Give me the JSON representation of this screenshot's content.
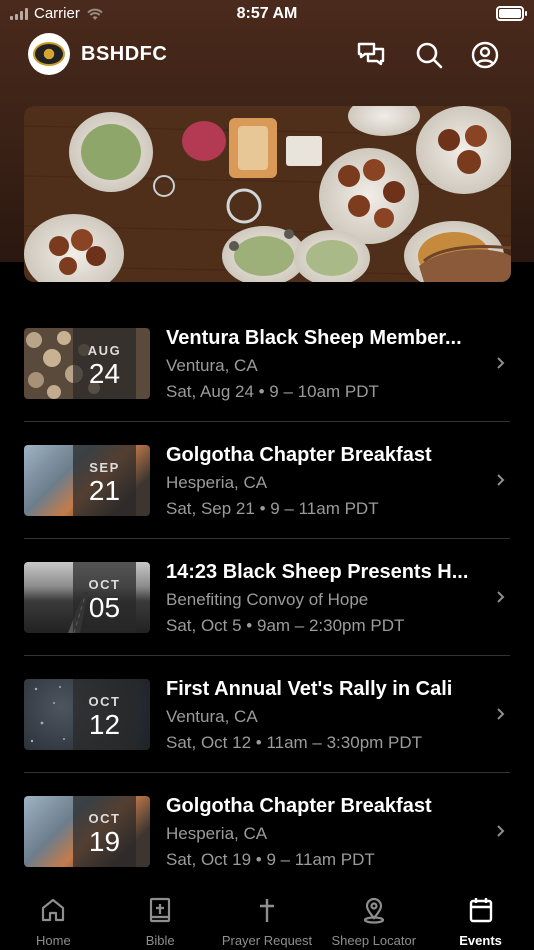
{
  "status_bar": {
    "carrier": "Carrier",
    "time": "8:57 AM"
  },
  "header": {
    "title": "BSHDFC",
    "icons": [
      "chat-icon",
      "search-icon",
      "profile-icon"
    ]
  },
  "events": [
    {
      "month": "AUG",
      "day": "24",
      "title": "Ventura Black Sheep Member...",
      "subtitle": "Ventura, CA",
      "time": "Sat, Aug 24 • 9 – 10am PDT",
      "thumb": "wood"
    },
    {
      "month": "SEP",
      "day": "21",
      "title": "Golgotha Chapter Breakfast",
      "subtitle": "Hesperia, CA",
      "time": "Sat, Sep 21 • 9 – 11am PDT",
      "thumb": "sky"
    },
    {
      "month": "OCT",
      "day": "05",
      "title": "14:23 Black Sheep Presents H...",
      "subtitle": "Benefiting Convoy of Hope",
      "time": "Sat, Oct 5 • 9am – 2:30pm PDT",
      "thumb": "road"
    },
    {
      "month": "OCT",
      "day": "12",
      "title": "First Annual Vet's Rally in Cali",
      "subtitle": "Ventura, CA",
      "time": "Sat, Oct 12 • 11am – 3:30pm PDT",
      "thumb": "rain"
    },
    {
      "month": "OCT",
      "day": "19",
      "title": "Golgotha Chapter Breakfast",
      "subtitle": "Hesperia, CA",
      "time": "Sat, Oct 19 • 9 – 11am PDT",
      "thumb": "sky"
    }
  ],
  "tabs": [
    {
      "label": "Home",
      "icon": "home-icon",
      "active": false
    },
    {
      "label": "Bible",
      "icon": "bible-icon",
      "active": false
    },
    {
      "label": "Prayer Request",
      "icon": "cross-icon",
      "active": false
    },
    {
      "label": "Sheep Locator",
      "icon": "location-pin-icon",
      "active": false
    },
    {
      "label": "Events",
      "icon": "calendar-icon",
      "active": true
    }
  ],
  "colors": {
    "background": "#000000",
    "header_gradient": "#4a2a1c",
    "secondary_text": "#9b9b9b"
  }
}
